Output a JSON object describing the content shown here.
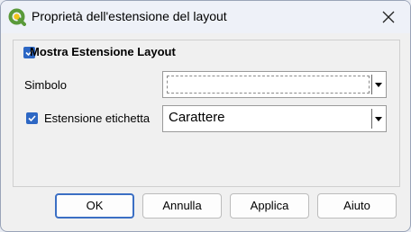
{
  "window": {
    "title": "Proprietà dell'estensione del layout"
  },
  "group": {
    "title": "Mostra Estensione Layout",
    "checked": true
  },
  "symbol": {
    "label": "Simbolo"
  },
  "label_extent": {
    "label": "Estensione etichetta",
    "checked": true,
    "font_value": "Carattere"
  },
  "buttons": {
    "ok": "OK",
    "cancel": "Annulla",
    "apply": "Applica",
    "help": "Aiuto"
  },
  "colors": {
    "accent": "#2d67c4",
    "default_border": "#3b6fc4",
    "qgis_green": "#5a9a3a",
    "qgis_yellow": "#f0c419"
  }
}
